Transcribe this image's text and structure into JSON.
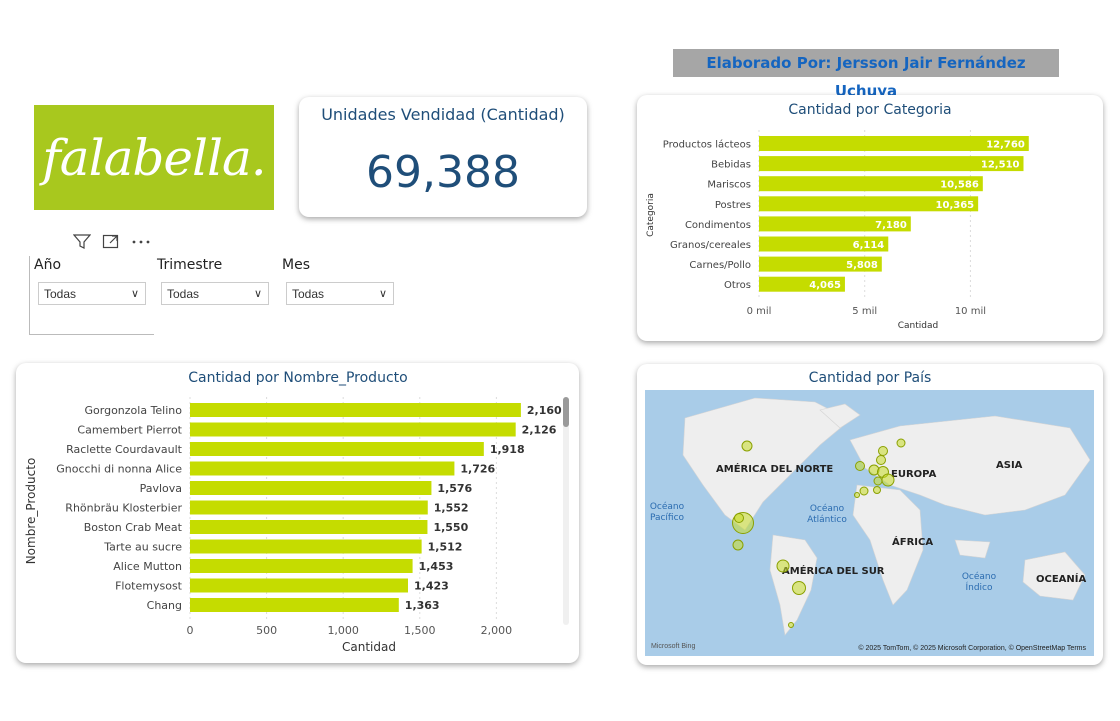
{
  "author": "Elaborado Por: Jersson Jair Fernández Uchuya",
  "logo": "falabella.",
  "kpi": {
    "title": "Unidades Vendidad (Cantidad)",
    "value": "69,388"
  },
  "toolbar": {
    "filter_icon": "filter-icon",
    "focus_icon": "focus-mode-icon",
    "more_icon": "more-options-icon"
  },
  "slicers": [
    {
      "label": "Año",
      "value": "Todas"
    },
    {
      "label": "Trimestre",
      "value": "Todas"
    },
    {
      "label": "Mes",
      "value": "Todas"
    }
  ],
  "colors": {
    "bar": "#c5dc00",
    "title": "#1f4e79",
    "map_bg": "#a9cce8",
    "land": "#eeeeee"
  },
  "chart_data": [
    {
      "type": "bar",
      "orientation": "horizontal",
      "title": "Cantidad por Categoria",
      "xlabel": "Cantidad",
      "ylabel": "Categoria",
      "categories": [
        "Productos lácteos",
        "Bebidas",
        "Mariscos",
        "Postres",
        "Condimentos",
        "Granos/cereales",
        "Carnes/Pollo",
        "Otros"
      ],
      "values": [
        12760,
        12510,
        10586,
        10365,
        7180,
        6114,
        5808,
        4065
      ],
      "value_labels": [
        "12,760",
        "12,510",
        "10,586",
        "10,365",
        "7,180",
        "6,114",
        "5,808",
        "4,065"
      ],
      "xticks": [
        "0 mil",
        "5 mil",
        "10 mil"
      ],
      "xtick_values": [
        0,
        5000,
        10000
      ],
      "xlim": [
        0,
        14000
      ],
      "grid": true
    },
    {
      "type": "bar",
      "orientation": "horizontal",
      "title": "Cantidad por Nombre_Producto",
      "xlabel": "Cantidad",
      "ylabel": "Nombre_Producto",
      "categories": [
        "Gorgonzola Telino",
        "Camembert Pierrot",
        "Raclette Courdavault",
        "Gnocchi di nonna Alice",
        "Pavlova",
        "Rhönbräu Klosterbier",
        "Boston Crab Meat",
        "Tarte au sucre",
        "Alice Mutton",
        "Flotemysost",
        "Chang"
      ],
      "values": [
        2160,
        2126,
        1918,
        1726,
        1576,
        1552,
        1550,
        1512,
        1453,
        1423,
        1363
      ],
      "value_labels": [
        "2,160",
        "2,126",
        "1,918",
        "1,726",
        "1,576",
        "1,552",
        "1,550",
        "1,512",
        "1,453",
        "1,423",
        "1,363"
      ],
      "xticks": [
        "0",
        "500",
        "1,000",
        "1,500",
        "2,000"
      ],
      "xtick_values": [
        0,
        500,
        1000,
        1500,
        2000
      ],
      "xlim": [
        0,
        2350
      ],
      "grid": true
    }
  ],
  "map": {
    "title": "Cantidad por País",
    "labels": {
      "na": "AMÉRICA DEL NORTE",
      "eu": "EUROPA",
      "asia": "ASIA",
      "africa": "ÁFRICA",
      "sa": "AMÉRICA DEL SUR",
      "oceania": "OCEANÍA",
      "pacific": "Océano Pacífico",
      "atlantic": "Océano Atlántico",
      "indian": "Océano Índico"
    },
    "credit": "© 2025 TomTom, © 2025 Microsoft Corporation, © OpenStreetMap  Terms",
    "brand": "Microsoft Bing"
  }
}
